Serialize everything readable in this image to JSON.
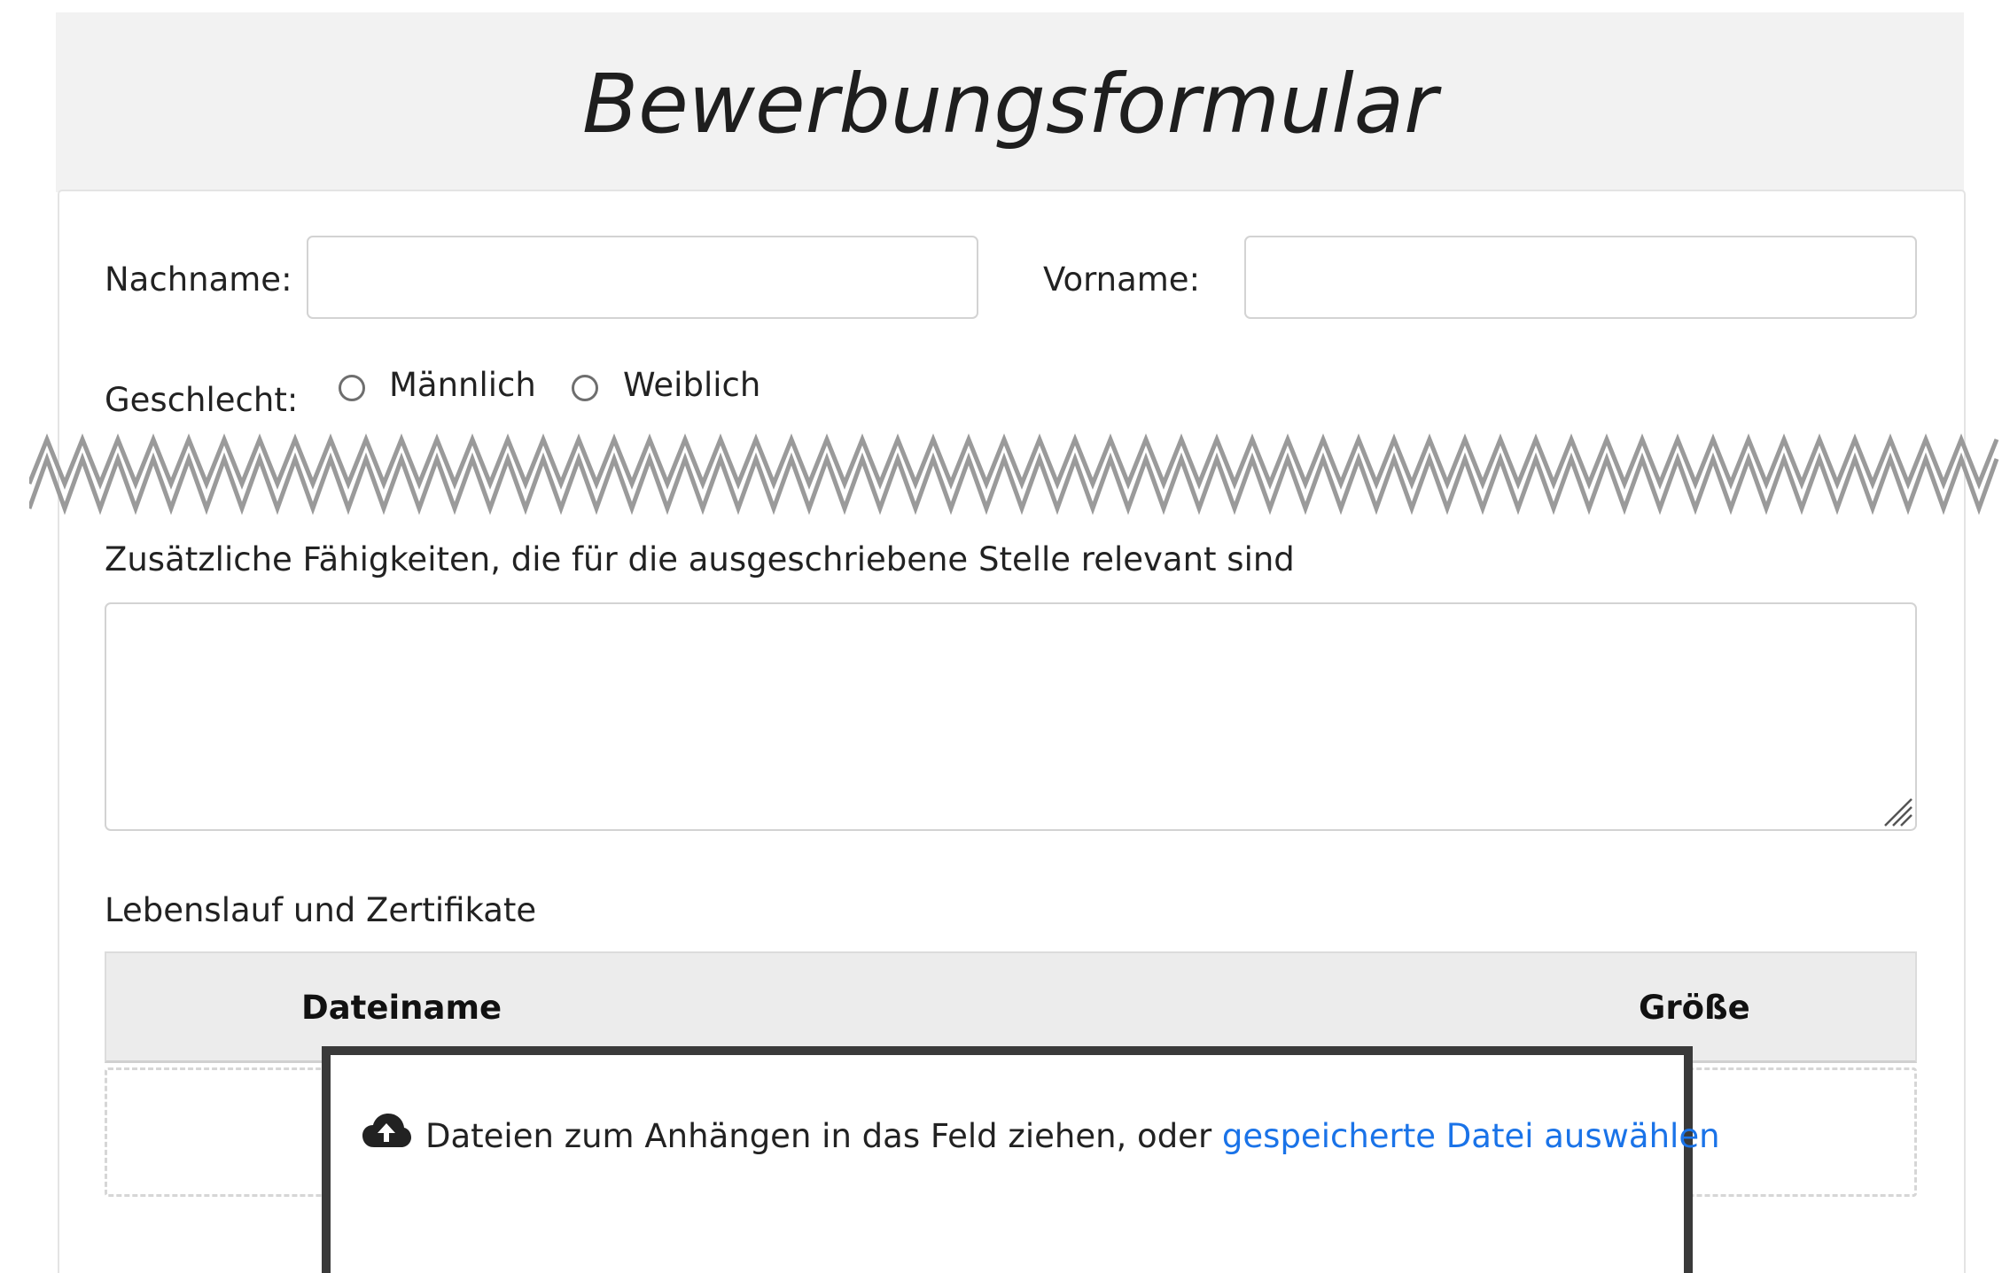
{
  "form": {
    "title": "Bewerbungsformular",
    "lastname_label": "Nachname:",
    "lastname_value": "",
    "firstname_label": "Vorname:",
    "firstname_value": "",
    "gender_label": "Geschlecht:",
    "gender_options": [
      "Männlich",
      "Weiblich"
    ],
    "skills_label": "Zusätzliche Fähigkeiten, die für die ausgeschriebene Stelle relevant sind",
    "skills_value": "",
    "attachments_label": "Lebenslauf und Zertifikate",
    "table_headers": {
      "filename": "Dateiname",
      "size": "Größe"
    },
    "dropzone": {
      "text": "Dateien zum Anhängen in das Feld ziehen, oder ",
      "link": "gespeicherte Datei auswählen",
      "icon": "cloud-upload-icon"
    }
  },
  "colors": {
    "link": "#1a73e8",
    "header_bg": "#f2f2f2",
    "table_header_bg": "#ececec",
    "highlight_border": "#3a3a3a"
  }
}
